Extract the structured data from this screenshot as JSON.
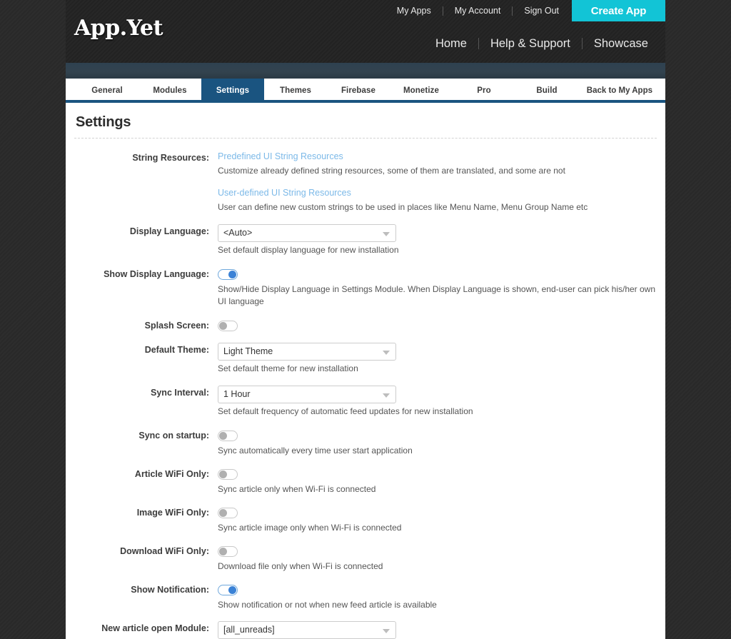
{
  "brand": {
    "logo_text": "App.Yet"
  },
  "header": {
    "util_links": [
      "My Apps",
      "My Account",
      "Sign Out"
    ],
    "create_app_label": "Create App",
    "main_links": [
      "Home",
      "Help & Support",
      "Showcase"
    ],
    "accent_color": "#12c4d6",
    "header_bg": "#232323"
  },
  "tabs": {
    "items": [
      {
        "label": "General",
        "active": false
      },
      {
        "label": "Modules",
        "active": false
      },
      {
        "label": "Settings",
        "active": true
      },
      {
        "label": "Themes",
        "active": false
      },
      {
        "label": "Firebase",
        "active": false
      },
      {
        "label": "Monetize",
        "active": false
      },
      {
        "label": "Pro",
        "active": false
      },
      {
        "label": "Build",
        "active": false
      }
    ],
    "back_label": "Back to My Apps",
    "active_color": "#1a5480"
  },
  "page": {
    "title": "Settings"
  },
  "form": {
    "string_resources": {
      "label": "String Resources:",
      "predefined_link": "Predefined UI String Resources",
      "predefined_help": "Customize already defined string resources, some of them are translated, and some are not",
      "user_defined_link": "User-defined UI String Resources",
      "user_defined_help": "User can define new custom strings to be used in places like Menu Name, Menu Group Name etc"
    },
    "display_language": {
      "label": "Display Language:",
      "value": "<Auto>",
      "help": "Set default display language for new installation"
    },
    "show_display_language": {
      "label": "Show Display Language:",
      "state": "on",
      "help": "Show/Hide Display Language in Settings Module. When Display Language is shown, end-user can pick his/her own UI language"
    },
    "splash_screen": {
      "label": "Splash Screen:",
      "state": "off",
      "help": ""
    },
    "default_theme": {
      "label": "Default Theme:",
      "value": "Light Theme",
      "help": "Set default theme for new installation"
    },
    "sync_interval": {
      "label": "Sync Interval:",
      "value": "1 Hour",
      "help": "Set default frequency of automatic feed updates for new installation"
    },
    "sync_on_startup": {
      "label": "Sync on startup:",
      "state": "off",
      "help": "Sync automatically every time user start application"
    },
    "article_wifi_only": {
      "label": "Article WiFi Only:",
      "state": "off",
      "help": "Sync article only when Wi-Fi is connected"
    },
    "image_wifi_only": {
      "label": "Image WiFi Only:",
      "state": "off",
      "help": "Sync article image only when Wi-Fi is connected"
    },
    "download_wifi_only": {
      "label": "Download WiFi Only:",
      "state": "off",
      "help": "Download file only when Wi-Fi is connected"
    },
    "show_notification": {
      "label": "Show Notification:",
      "state": "on",
      "help": "Show notification or not when new feed article is available"
    },
    "new_article_open_module": {
      "label": "New article open Module:",
      "value": "[all_unreads]",
      "help": ""
    }
  }
}
